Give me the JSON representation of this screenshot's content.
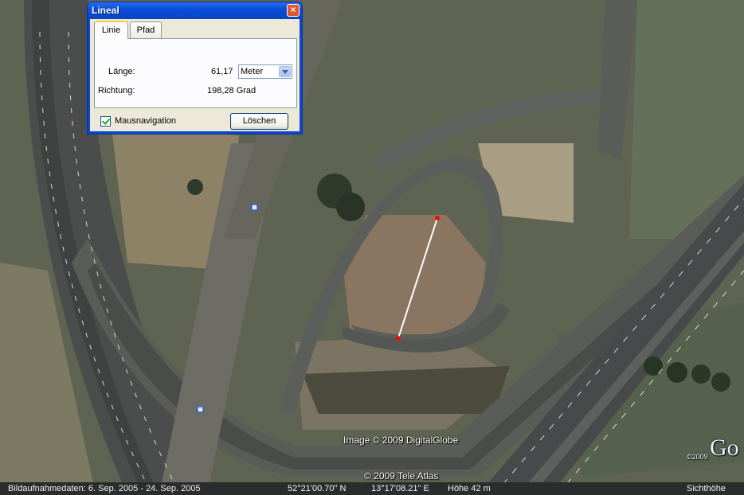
{
  "dialog": {
    "title": "Lineal",
    "close_icon": "close-icon",
    "tabs": [
      {
        "label": "Linie",
        "selected": true
      },
      {
        "label": "Pfad",
        "selected": false
      }
    ],
    "length_label": "Länge:",
    "length_value": "61,17",
    "unit_selected": "Meter",
    "direction_label": "Richtung:",
    "direction_value": "198,28 Grad",
    "mouse_nav_label": "Mausnavigation",
    "mouse_nav_checked": true,
    "clear_button": "Löschen"
  },
  "map": {
    "credit_image": "Image © 2009 DigitalGlobe",
    "credit_data": "© 2009 Tele Atlas",
    "logo_year": "©2009",
    "logo_text": "Go",
    "ruler_color": "#ffffff",
    "endpoint_color": "#ff0000"
  },
  "statusbar": {
    "imagery_date": "Bildaufnahmedaten:  6. Sep. 2005 - 24. Sep. 2005",
    "latitude": "52°21'00.70\"  N",
    "longitude": "13°17'08.21\"  E",
    "altitude": "Höhe   42 m",
    "eye_altitude": "Sichthöhe"
  }
}
